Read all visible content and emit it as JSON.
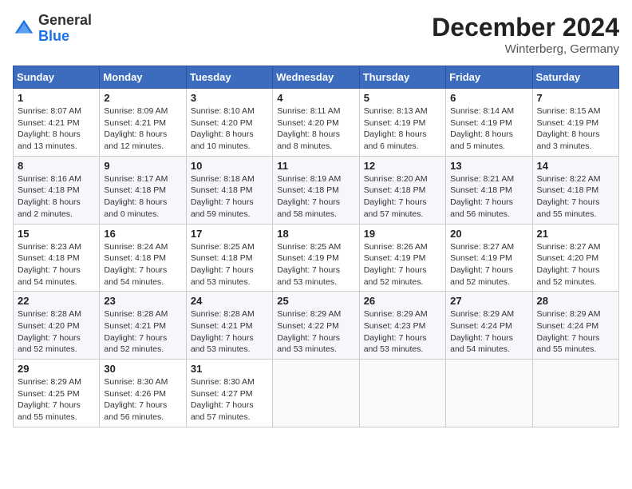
{
  "header": {
    "logo_general": "General",
    "logo_blue": "Blue",
    "month_year": "December 2024",
    "location": "Winterberg, Germany"
  },
  "calendar": {
    "days_of_week": [
      "Sunday",
      "Monday",
      "Tuesday",
      "Wednesday",
      "Thursday",
      "Friday",
      "Saturday"
    ],
    "weeks": [
      [
        {
          "day": "1",
          "sunrise": "8:07 AM",
          "sunset": "4:21 PM",
          "daylight": "8 hours and 13 minutes."
        },
        {
          "day": "2",
          "sunrise": "8:09 AM",
          "sunset": "4:21 PM",
          "daylight": "8 hours and 12 minutes."
        },
        {
          "day": "3",
          "sunrise": "8:10 AM",
          "sunset": "4:20 PM",
          "daylight": "8 hours and 10 minutes."
        },
        {
          "day": "4",
          "sunrise": "8:11 AM",
          "sunset": "4:20 PM",
          "daylight": "8 hours and 8 minutes."
        },
        {
          "day": "5",
          "sunrise": "8:13 AM",
          "sunset": "4:19 PM",
          "daylight": "8 hours and 6 minutes."
        },
        {
          "day": "6",
          "sunrise": "8:14 AM",
          "sunset": "4:19 PM",
          "daylight": "8 hours and 5 minutes."
        },
        {
          "day": "7",
          "sunrise": "8:15 AM",
          "sunset": "4:19 PM",
          "daylight": "8 hours and 3 minutes."
        }
      ],
      [
        {
          "day": "8",
          "sunrise": "8:16 AM",
          "sunset": "4:18 PM",
          "daylight": "8 hours and 2 minutes."
        },
        {
          "day": "9",
          "sunrise": "8:17 AM",
          "sunset": "4:18 PM",
          "daylight": "8 hours and 0 minutes."
        },
        {
          "day": "10",
          "sunrise": "8:18 AM",
          "sunset": "4:18 PM",
          "daylight": "7 hours and 59 minutes."
        },
        {
          "day": "11",
          "sunrise": "8:19 AM",
          "sunset": "4:18 PM",
          "daylight": "7 hours and 58 minutes."
        },
        {
          "day": "12",
          "sunrise": "8:20 AM",
          "sunset": "4:18 PM",
          "daylight": "7 hours and 57 minutes."
        },
        {
          "day": "13",
          "sunrise": "8:21 AM",
          "sunset": "4:18 PM",
          "daylight": "7 hours and 56 minutes."
        },
        {
          "day": "14",
          "sunrise": "8:22 AM",
          "sunset": "4:18 PM",
          "daylight": "7 hours and 55 minutes."
        }
      ],
      [
        {
          "day": "15",
          "sunrise": "8:23 AM",
          "sunset": "4:18 PM",
          "daylight": "7 hours and 54 minutes."
        },
        {
          "day": "16",
          "sunrise": "8:24 AM",
          "sunset": "4:18 PM",
          "daylight": "7 hours and 54 minutes."
        },
        {
          "day": "17",
          "sunrise": "8:25 AM",
          "sunset": "4:18 PM",
          "daylight": "7 hours and 53 minutes."
        },
        {
          "day": "18",
          "sunrise": "8:25 AM",
          "sunset": "4:19 PM",
          "daylight": "7 hours and 53 minutes."
        },
        {
          "day": "19",
          "sunrise": "8:26 AM",
          "sunset": "4:19 PM",
          "daylight": "7 hours and 52 minutes."
        },
        {
          "day": "20",
          "sunrise": "8:27 AM",
          "sunset": "4:19 PM",
          "daylight": "7 hours and 52 minutes."
        },
        {
          "day": "21",
          "sunrise": "8:27 AM",
          "sunset": "4:20 PM",
          "daylight": "7 hours and 52 minutes."
        }
      ],
      [
        {
          "day": "22",
          "sunrise": "8:28 AM",
          "sunset": "4:20 PM",
          "daylight": "7 hours and 52 minutes."
        },
        {
          "day": "23",
          "sunrise": "8:28 AM",
          "sunset": "4:21 PM",
          "daylight": "7 hours and 52 minutes."
        },
        {
          "day": "24",
          "sunrise": "8:28 AM",
          "sunset": "4:21 PM",
          "daylight": "7 hours and 53 minutes."
        },
        {
          "day": "25",
          "sunrise": "8:29 AM",
          "sunset": "4:22 PM",
          "daylight": "7 hours and 53 minutes."
        },
        {
          "day": "26",
          "sunrise": "8:29 AM",
          "sunset": "4:23 PM",
          "daylight": "7 hours and 53 minutes."
        },
        {
          "day": "27",
          "sunrise": "8:29 AM",
          "sunset": "4:24 PM",
          "daylight": "7 hours and 54 minutes."
        },
        {
          "day": "28",
          "sunrise": "8:29 AM",
          "sunset": "4:24 PM",
          "daylight": "7 hours and 55 minutes."
        }
      ],
      [
        {
          "day": "29",
          "sunrise": "8:29 AM",
          "sunset": "4:25 PM",
          "daylight": "7 hours and 55 minutes."
        },
        {
          "day": "30",
          "sunrise": "8:30 AM",
          "sunset": "4:26 PM",
          "daylight": "7 hours and 56 minutes."
        },
        {
          "day": "31",
          "sunrise": "8:30 AM",
          "sunset": "4:27 PM",
          "daylight": "7 hours and 57 minutes."
        },
        null,
        null,
        null,
        null
      ]
    ]
  }
}
